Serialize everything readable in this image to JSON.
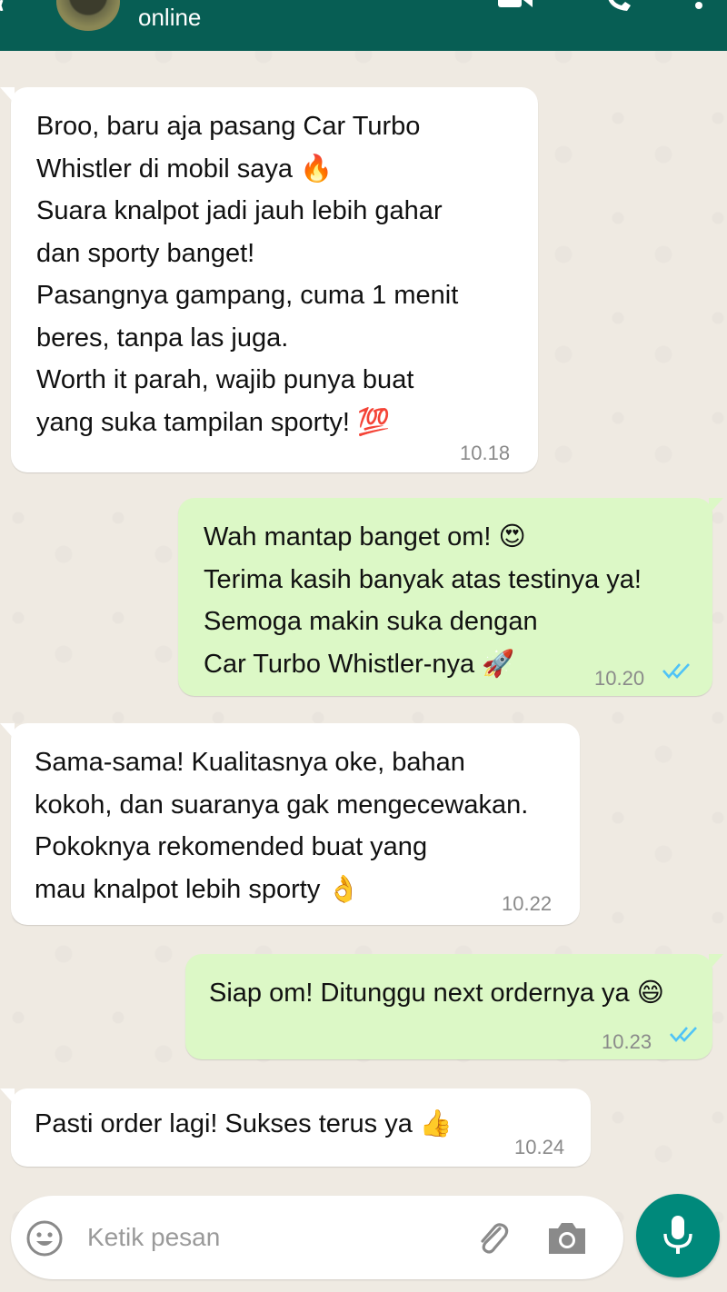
{
  "header": {
    "status": "online",
    "colors": {
      "bar": "#075e54"
    }
  },
  "messages": [
    {
      "direction": "incoming",
      "lines": [
        "Broo, baru aja pasang Car Turbo",
        "Whistler di mobil saya 🔥",
        "Suara knalpot jadi jauh lebih gahar",
        "dan sporty banget!",
        "Pasangnya gampang, cuma 1 menit",
        "beres, tanpa las juga.",
        "Worth it parah, wajib punya buat",
        "yang suka tampilan sporty! 💯"
      ],
      "time": "10.18"
    },
    {
      "direction": "outgoing",
      "lines": [
        "Wah mantap banget om! 😍",
        "Terima kasih banyak atas testinya ya!",
        "Semoga makin suka dengan",
        "Car Turbo Whistler-nya 🚀"
      ],
      "time": "10.20",
      "read": true
    },
    {
      "direction": "incoming",
      "lines": [
        "Sama-sama! Kualitasnya oke, bahan",
        "kokoh, dan suaranya gak mengecewakan.",
        "Pokoknya rekomended buat yang",
        "mau knalpot lebih sporty 👌"
      ],
      "time": "10.22"
    },
    {
      "direction": "outgoing",
      "lines": [
        "Siap om! Ditunggu next ordernya ya 😄"
      ],
      "time": "10.23",
      "read": true
    },
    {
      "direction": "incoming",
      "lines": [
        "Pasti order lagi! Sukses terus ya 👍"
      ],
      "time": "10.24"
    }
  ],
  "composer": {
    "placeholder": "Ketik pesan",
    "icons": [
      "emoji-icon",
      "paperclip-icon",
      "camera-icon",
      "microphone-icon"
    ]
  },
  "colors": {
    "incoming_bubble": "#ffffff",
    "outgoing_bubble": "#dcf8c6",
    "read_ticks": "#4fc3f7",
    "mic_button": "#00897b",
    "chat_background": "#efeae2"
  }
}
